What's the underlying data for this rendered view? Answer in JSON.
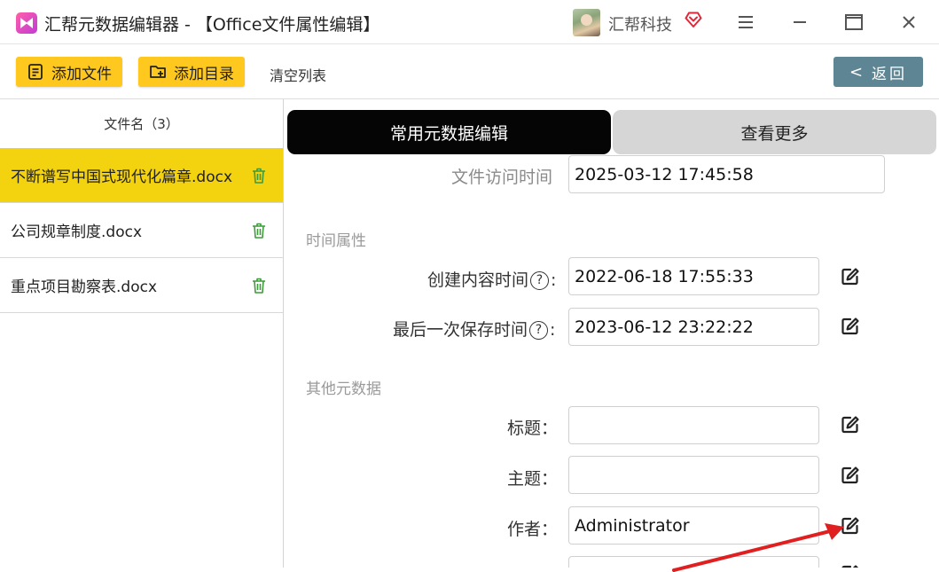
{
  "window": {
    "title": "汇帮元数据编辑器 - 【Office文件属性编辑】",
    "company": "汇帮科技",
    "controls": [
      "menu-icon",
      "minimize-icon",
      "maximize-icon",
      "close-icon"
    ]
  },
  "toolbar": {
    "add_file_label": "添加文件",
    "add_dir_label": "添加目录",
    "clear_label": "清空列表",
    "back_label": "返回",
    "accent_color": "#ffc81e",
    "back_color": "#5e8593"
  },
  "file_list": {
    "header": "文件名（3）",
    "items": [
      {
        "name": "不断谱写中国式现代化篇章.docx",
        "selected": true
      },
      {
        "name": "公司规章制度.docx",
        "selected": false
      },
      {
        "name": "重点项目勘察表.docx",
        "selected": false
      }
    ],
    "selected_color": "#f3d20f"
  },
  "tabs": {
    "common": "常用元数据编辑",
    "more": "查看更多"
  },
  "fields": {
    "access_time": {
      "label": "文件访问时间",
      "value": "2025-03-12 17:45:58"
    },
    "time_section": "时间属性",
    "created": {
      "label": "创建内容时间",
      "help": "?",
      "colon": ":",
      "value": "2022-06-18 17:55:33"
    },
    "last_saved": {
      "label": "最后一次保存时间",
      "help": "?",
      "colon": ":",
      "value": "2023-06-12 23:22:22"
    },
    "other_section": "其他元数据",
    "title": {
      "label": "标题：",
      "value": ""
    },
    "subject": {
      "label": "主题：",
      "value": ""
    },
    "author": {
      "label": "作者：",
      "value": "Administrator"
    }
  },
  "annotation": {
    "arrow_color": "#e02020"
  }
}
